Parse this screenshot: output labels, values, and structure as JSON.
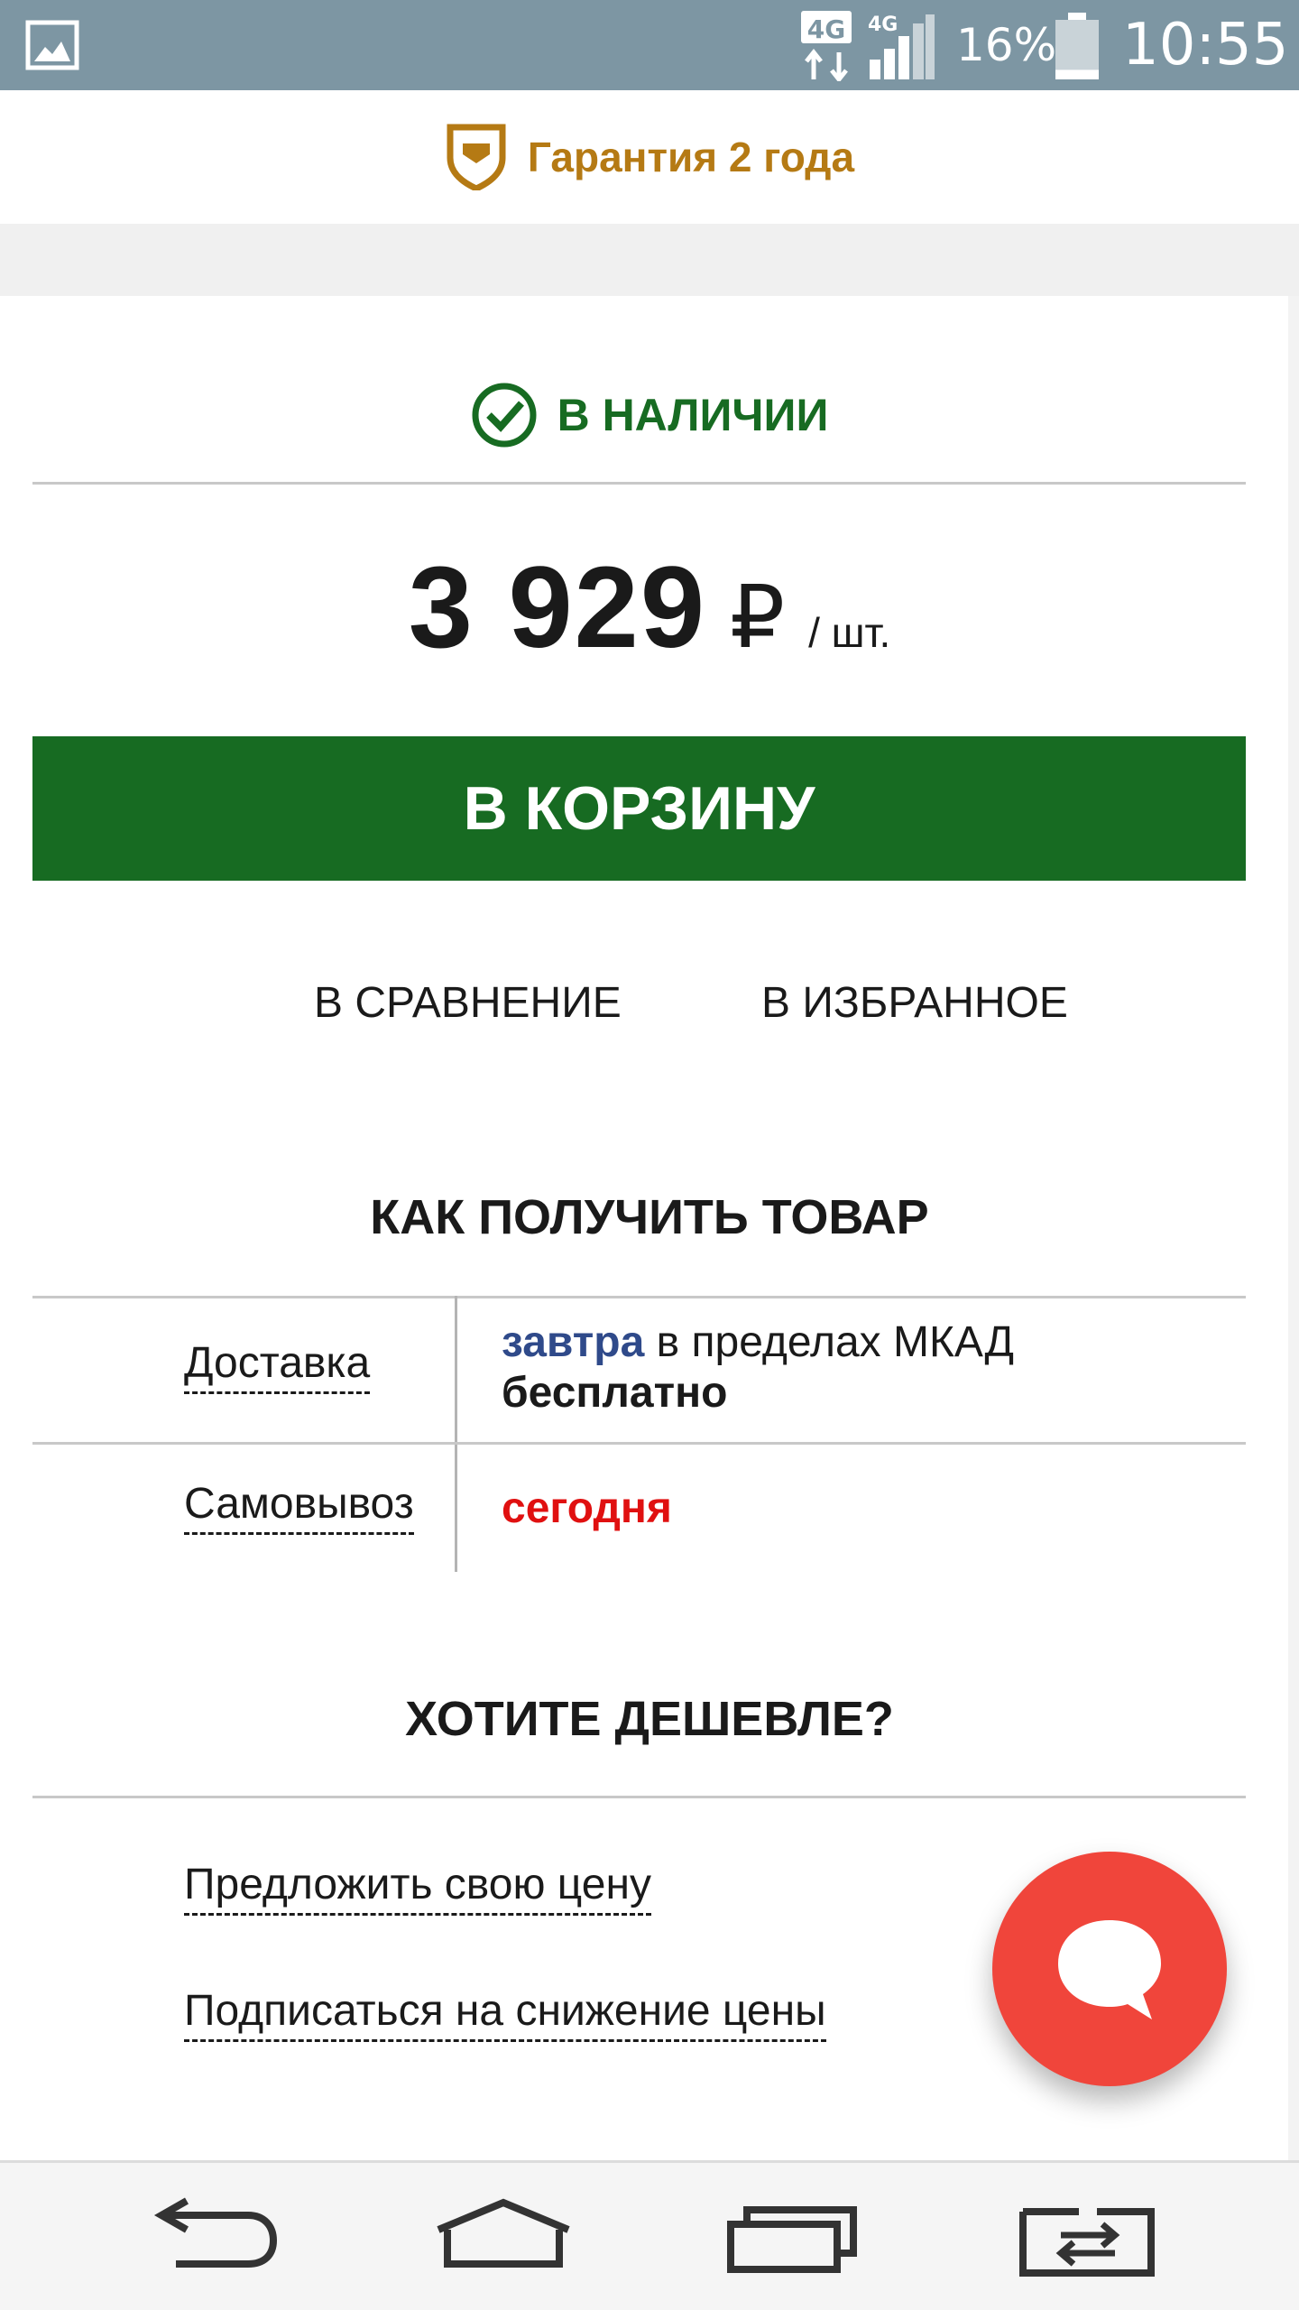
{
  "status_bar": {
    "network_label": "4G",
    "signal_label": "4G",
    "battery_percent": "16%",
    "battery_level": 0.16,
    "time": "10:55",
    "background_color": "#7d96a3"
  },
  "guarantee": {
    "text": "Гарантия 2 года",
    "icon": "shield-icon",
    "color": "#b57a14"
  },
  "availability": {
    "text": "В НАЛИЧИИ",
    "icon": "check-circle-icon",
    "color": "#176b22"
  },
  "price": {
    "value": "3 929",
    "currency": "₽",
    "unit": "/ шт."
  },
  "actions": {
    "cart_label": "В КОРЗИНУ",
    "cart_color": "#176b22",
    "compare_label": "В СРАВНЕНИЕ",
    "favorites_label": "В ИЗБРАННОЕ"
  },
  "delivery": {
    "title": "КАК ПОЛУЧИТЬ ТОВАР",
    "rows": [
      {
        "label": "Доставка",
        "when": "завтра",
        "where": " в пределах МКАД",
        "cost": "бесплатно"
      },
      {
        "label": "Самовывоз",
        "when": "сегодня"
      }
    ]
  },
  "cheaper": {
    "title": "ХОТИТЕ ДЕШЕВЛЕ?",
    "links": [
      "Предложить свою цену",
      "Подписаться на снижение цены"
    ]
  },
  "chat_button": {
    "icon": "chat-bubble-icon",
    "color": "#f0453b"
  },
  "navigation_bar": {
    "buttons": [
      "back-icon",
      "home-icon",
      "recent-apps-icon",
      "dual-window-icon"
    ]
  }
}
